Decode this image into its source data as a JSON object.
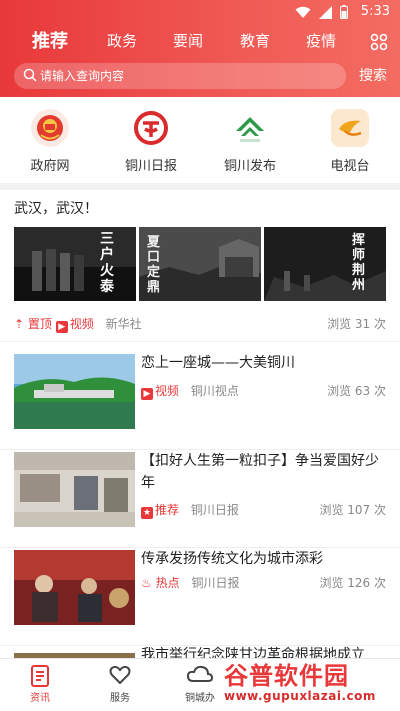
{
  "status": {
    "time": "5:33"
  },
  "tabs": [
    "推荐",
    "政务",
    "要闻",
    "教育",
    "疫情"
  ],
  "search": {
    "placeholder": "请输入查询内容",
    "button": "搜索"
  },
  "quick_links": [
    {
      "label": "政府网",
      "icon": "national-emblem-icon"
    },
    {
      "label": "铜川日报",
      "icon": "tongchuan-daily-logo-icon"
    },
    {
      "label": "铜川发布",
      "icon": "tongchuan-release-logo-icon"
    },
    {
      "label": "电视台",
      "icon": "tv-station-logo-icon"
    }
  ],
  "feature": {
    "title": "武汉，武汉！",
    "images": [
      {
        "caption": "三户火泰",
        "icon": "video-still-image"
      },
      {
        "caption": "夏口定鼎",
        "icon": "video-still-image"
      },
      {
        "caption": "挥师荆州",
        "icon": "video-still-image"
      }
    ],
    "tag1": "置顶",
    "tag2": "视频",
    "source": "新华社",
    "views": "浏览 31 次"
  },
  "news": [
    {
      "title": "恋上一座城——大美铜川",
      "tag": "视频",
      "source": "铜川视点",
      "views": "浏览 63 次"
    },
    {
      "title": "【扣好人生第一粒扣子】争当爱国好少年",
      "tag": "推荐",
      "source": "铜川日报",
      "views": "浏览 107 次"
    },
    {
      "title": "传承发扬传统文化为城市添彩",
      "tag": "热点",
      "source": "铜川日报",
      "views": "浏览 126 次"
    },
    {
      "title": "我市举行纪念陕甘边革命根据地成立"
    }
  ],
  "bottom_nav": [
    "资讯",
    "服务",
    "铜城办"
  ],
  "watermark": {
    "text": "谷普软件园",
    "url": "www.gupuxlazai.com"
  },
  "colors": {
    "brand": "#e8383a",
    "tag_red": "#e8383a"
  }
}
